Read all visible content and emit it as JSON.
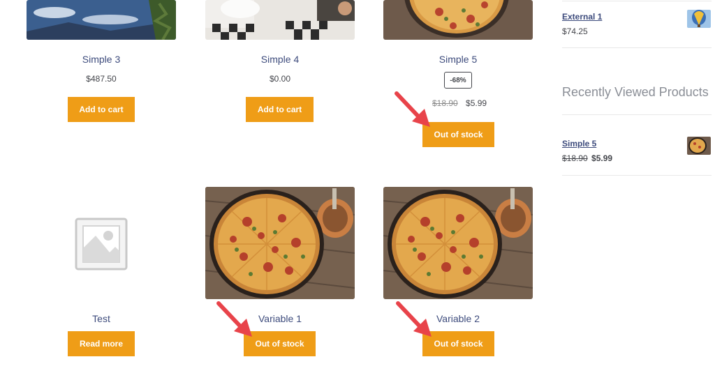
{
  "products": [
    {
      "title": "Simple 3",
      "price": "$487.50",
      "button": "Add to cart"
    },
    {
      "title": "Simple 4",
      "price": "$0.00",
      "button": "Add to cart"
    },
    {
      "title": "Simple 5",
      "badge": "-68%",
      "old_price": "$18.90",
      "price": "$5.99",
      "button": "Out of stock"
    },
    {
      "title": "Test",
      "button": "Read more"
    },
    {
      "title": "Variable 1",
      "button": "Out of stock"
    },
    {
      "title": "Variable 2",
      "button": "Out of stock"
    }
  ],
  "sidebar": {
    "product_list": [
      {
        "name": "External 1",
        "price": "$74.25"
      }
    ],
    "recently_viewed_heading": "Recently Viewed Products",
    "recently_viewed": [
      {
        "name": "Simple 5",
        "old_price": "$18.90",
        "price": "$5.99"
      }
    ]
  },
  "colors": {
    "button": "#ef9d17",
    "link": "#3d4b7c",
    "arrow": "#e8434a"
  }
}
